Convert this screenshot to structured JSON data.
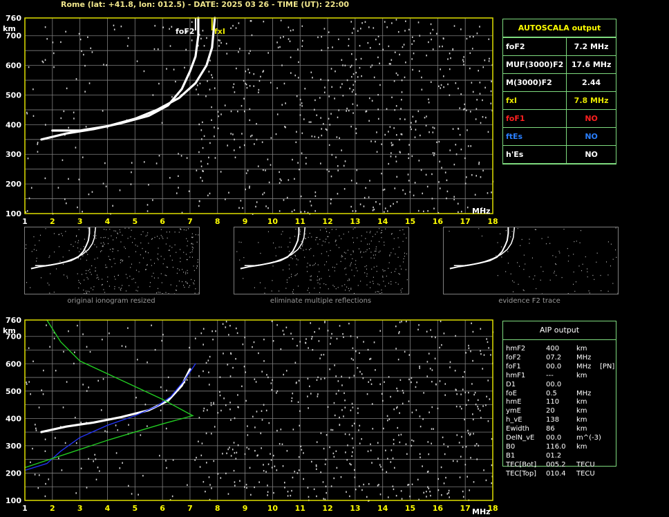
{
  "header": "Rome (lat: +41.8, lon: 012.5) - DATE: 2025 03 26 - TIME (UT): 22:00",
  "colors": {
    "frame": "#e0e000",
    "grid": "#808080",
    "trace": "#ffffff",
    "profile": "#2233ee",
    "model": "#22cc22",
    "fxi_marker": "#e0e000",
    "panel_border": "#7fdc7f"
  },
  "top_chart": {
    "y_unit": "km",
    "x_unit": "MHz",
    "x_ticks": [
      "1",
      "2",
      "3",
      "4",
      "5",
      "6",
      "7",
      "8",
      "9",
      "10",
      "11",
      "12",
      "13",
      "14",
      "15",
      "16",
      "17",
      "18"
    ],
    "y_ticks": [
      "760",
      "700",
      "600",
      "500",
      "400",
      "300",
      "200",
      "100"
    ],
    "labels": {
      "foF2": "foF2",
      "fxI": "fxI"
    }
  },
  "bottom_chart": {
    "y_unit": "km",
    "x_unit": "MHz",
    "x_ticks": [
      "1",
      "2",
      "3",
      "4",
      "5",
      "6",
      "7",
      "8",
      "9",
      "10",
      "11",
      "12",
      "13",
      "14",
      "15",
      "16",
      "17",
      "18"
    ],
    "y_ticks": [
      "760",
      "700",
      "600",
      "500",
      "400",
      "300",
      "200",
      "100"
    ]
  },
  "thumbnails": [
    {
      "caption": "original ionogram resized"
    },
    {
      "caption": "eliminate multiple reflections"
    },
    {
      "caption": "evidence F2 trace"
    }
  ],
  "autoscala": {
    "title": "AUTOSCALA output",
    "rows": [
      {
        "param": "foF2",
        "value": "7.2 MHz",
        "param_color": "#ffffff",
        "value_color": "#ffffff"
      },
      {
        "param": "MUF(3000)F2",
        "value": "17.6 MHz",
        "param_color": "#ffffff",
        "value_color": "#ffffff"
      },
      {
        "param": "M(3000)F2",
        "value": "2.44",
        "param_color": "#ffffff",
        "value_color": "#ffffff"
      },
      {
        "param": "fxI",
        "value": "7.8 MHz",
        "param_color": "#e6e600",
        "value_color": "#e6e600"
      },
      {
        "param": "foF1",
        "value": "NO",
        "param_color": "#ff2020",
        "value_color": "#ff2020"
      },
      {
        "param": "ftEs",
        "value": "NO",
        "param_color": "#2a7fff",
        "value_color": "#2a7fff"
      },
      {
        "param": "h'Es",
        "value": "NO",
        "param_color": "#ffffff",
        "value_color": "#ffffff"
      }
    ]
  },
  "aip": {
    "title": "AIP output",
    "rows": [
      {
        "param": "hmF2",
        "value": "400",
        "unit": "km",
        "extra": ""
      },
      {
        "param": "foF2",
        "value": "07.2",
        "unit": "MHz",
        "extra": ""
      },
      {
        "param": "foF1",
        "value": "00.0",
        "unit": "MHz",
        "extra": "[PN]"
      },
      {
        "param": "hmF1",
        "value": "---",
        "unit": "km",
        "extra": ""
      },
      {
        "param": "D1",
        "value": "00.0",
        "unit": "",
        "extra": ""
      },
      {
        "param": "foE",
        "value": "0.5",
        "unit": "MHz",
        "extra": ""
      },
      {
        "param": "hmE",
        "value": "110",
        "unit": "km",
        "extra": ""
      },
      {
        "param": "ymE",
        "value": "20",
        "unit": "km",
        "extra": ""
      },
      {
        "param": "h_vE",
        "value": "138",
        "unit": "km",
        "extra": ""
      },
      {
        "param": "Ewidth",
        "value": "86",
        "unit": "km",
        "extra": ""
      },
      {
        "param": "DelN_vE",
        "value": "00.0",
        "unit": "m^(-3)",
        "extra": ""
      },
      {
        "param": "B0",
        "value": "116.0",
        "unit": "km",
        "extra": ""
      },
      {
        "param": "B1",
        "value": "01.2",
        "unit": "",
        "extra": ""
      },
      {
        "param": "TEC[Bot]",
        "value": "005.2",
        "unit": "TECU",
        "extra": ""
      },
      {
        "param": "TEC[Top]",
        "value": "010.4",
        "unit": "TECU",
        "extra": ""
      }
    ]
  },
  "chart_data": [
    {
      "type": "scatter",
      "name": "ionogram-top",
      "xlim": [
        1,
        18
      ],
      "ylim": [
        100,
        760
      ],
      "grid": true,
      "series": [
        {
          "name": "",
          "color": "#ffffff",
          "points": [
            [
              1.6,
              350
            ],
            [
              2.5,
              370
            ],
            [
              3.5,
              385
            ],
            [
              4.5,
              405
            ],
            [
              5.5,
              430
            ],
            [
              6.2,
              465
            ],
            [
              6.7,
              520
            ],
            [
              7.0,
              580
            ],
            [
              7.2,
              630
            ],
            [
              7.3,
              700
            ],
            [
              7.3,
              760
            ]
          ]
        },
        {
          "name": "",
          "color": "#ffffff",
          "points": [
            [
              2.0,
              380
            ],
            [
              3.0,
              380
            ],
            [
              4.0,
              395
            ],
            [
              5.0,
              420
            ],
            [
              5.8,
              450
            ],
            [
              6.6,
              490
            ],
            [
              7.2,
              540
            ],
            [
              7.6,
              600
            ],
            [
              7.8,
              660
            ],
            [
              7.9,
              760
            ]
          ]
        }
      ],
      "markers": {
        "foF2": 7.2,
        "fxI": 7.8
      }
    },
    {
      "type": "line",
      "name": "ionogram-bottom",
      "xlim": [
        1,
        18
      ],
      "ylim": [
        100,
        760
      ],
      "grid": true,
      "series": [
        {
          "name": "",
          "color": "#ffffff",
          "points": [
            [
              1.6,
              350
            ],
            [
              2.5,
              370
            ],
            [
              3.5,
              385
            ],
            [
              4.5,
              405
            ],
            [
              5.5,
              430
            ],
            [
              6.2,
              465
            ],
            [
              6.7,
              520
            ],
            [
              7.0,
              580
            ]
          ]
        },
        {
          "name": "",
          "color": "#2233ee",
          "points": [
            [
              1.0,
              210
            ],
            [
              1.8,
              235
            ],
            [
              2.3,
              280
            ],
            [
              3.0,
              330
            ],
            [
              4.0,
              375
            ],
            [
              5.0,
              410
            ],
            [
              5.8,
              445
            ],
            [
              6.3,
              480
            ],
            [
              6.8,
              540
            ],
            [
              7.2,
              600
            ]
          ]
        },
        {
          "name": "",
          "color": "#22cc22",
          "points": [
            [
              1.0,
              220
            ],
            [
              2.5,
              270
            ],
            [
              4.0,
              320
            ],
            [
              5.0,
              350
            ],
            [
              6.0,
              380
            ],
            [
              7.1,
              410
            ],
            [
              6.0,
              470
            ],
            [
              4.5,
              540
            ],
            [
              3.0,
              610
            ],
            [
              2.3,
              680
            ],
            [
              1.8,
              760
            ]
          ]
        }
      ]
    }
  ]
}
